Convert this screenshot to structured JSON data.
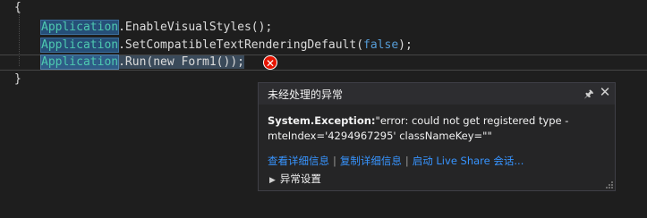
{
  "code": {
    "open_brace": "{",
    "line1": {
      "cls": "Application",
      "rest": ".EnableVisualStyles();"
    },
    "line2": {
      "cls": "Application",
      "rest_a": ".SetCompatibleTextRenderingDefault(",
      "kw": "false",
      "rest_b": ");"
    },
    "line3": {
      "cls": "Application",
      "rest": ".Run(new Form1());"
    },
    "close_brace": "}"
  },
  "error_marker": {
    "icon": "error-x-icon",
    "glyph": "✕",
    "color": "#e51400"
  },
  "exception_popup": {
    "title": "未经处理的异常",
    "pin_glyph": "🖈",
    "close_glyph": "✕",
    "exception_type": "System.Exception:",
    "message": "\"error: could not get registered type - mteIndex='4294967295' classNameKey=\"\"",
    "links": [
      "查看详细信息",
      "复制详细信息",
      "启动 Live Share 会话..."
    ],
    "separator": "|",
    "settings_label": "异常设置",
    "settings_chevron": "▶"
  },
  "colors": {
    "editor_bg": "#1e1e1e",
    "class_name": "#4ec9b0",
    "keyword": "#569cd6",
    "link": "#3794ff"
  }
}
